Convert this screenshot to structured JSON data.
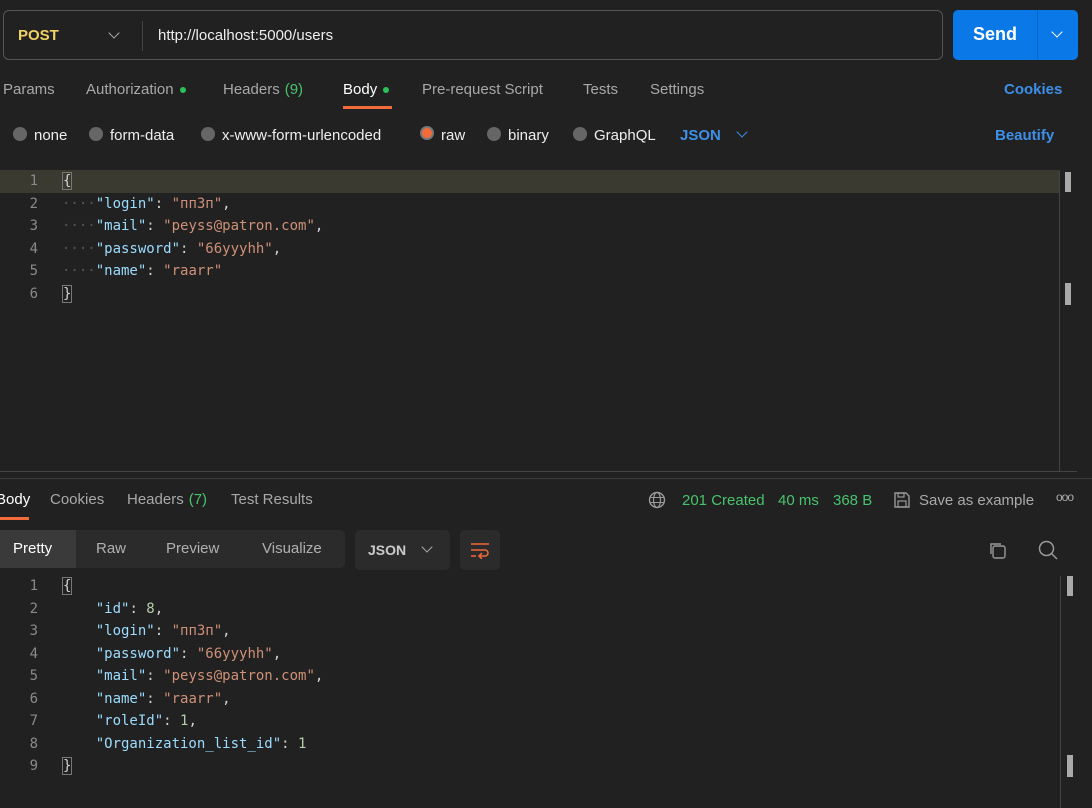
{
  "request": {
    "method": "POST",
    "url": "http://localhost:5000/users",
    "send_label": "Send",
    "tabs": [
      {
        "label": "Params"
      },
      {
        "label": "Authorization",
        "dot": true
      },
      {
        "label": "Headers",
        "count": "(9)"
      },
      {
        "label": "Body",
        "dot": true,
        "active": true
      },
      {
        "label": "Pre-request Script"
      },
      {
        "label": "Tests"
      },
      {
        "label": "Settings"
      }
    ],
    "cookies_label": "Cookies",
    "body_modes": [
      "none",
      "form-data",
      "x-www-form-urlencoded",
      "raw",
      "binary",
      "GraphQL"
    ],
    "selected_mode": "raw",
    "language": "JSON",
    "beautify_label": "Beautify",
    "body_lines": [
      [
        {
          "t": "p",
          "v": "{"
        }
      ],
      [
        {
          "t": "ws",
          "v": "····"
        },
        {
          "t": "k",
          "v": "\"login\""
        },
        {
          "t": "p",
          "v": ": "
        },
        {
          "t": "s",
          "v": "\"пп3п\""
        },
        {
          "t": "p",
          "v": ","
        }
      ],
      [
        {
          "t": "ws",
          "v": "····"
        },
        {
          "t": "k",
          "v": "\"mail\""
        },
        {
          "t": "p",
          "v": ": "
        },
        {
          "t": "s",
          "v": "\"peyss@patron.com\""
        },
        {
          "t": "p",
          "v": ","
        }
      ],
      [
        {
          "t": "ws",
          "v": "····"
        },
        {
          "t": "k",
          "v": "\"password\""
        },
        {
          "t": "p",
          "v": ": "
        },
        {
          "t": "s",
          "v": "\"66yyyhh\""
        },
        {
          "t": "p",
          "v": ","
        }
      ],
      [
        {
          "t": "ws",
          "v": "····"
        },
        {
          "t": "k",
          "v": "\"name\""
        },
        {
          "t": "p",
          "v": ": "
        },
        {
          "t": "s",
          "v": "\"raarr\""
        }
      ],
      [
        {
          "t": "p",
          "v": "}"
        }
      ]
    ]
  },
  "response": {
    "tabs": [
      {
        "label": "Body",
        "active": true
      },
      {
        "label": "Cookies"
      },
      {
        "label": "Headers",
        "count": "(7)"
      },
      {
        "label": "Test Results"
      }
    ],
    "status": "201 Created",
    "time": "40 ms",
    "size": "368 B",
    "save_label": "Save as example",
    "more_label": "ooo",
    "views": [
      "Pretty",
      "Raw",
      "Preview",
      "Visualize"
    ],
    "selected_view": "Pretty",
    "format": "JSON",
    "colors": {
      "status": "#47c46b",
      "accent": "#f26b3a",
      "send": "#0a78e6"
    },
    "body_lines": [
      [
        {
          "t": "p",
          "v": "{"
        }
      ],
      [
        {
          "t": "ws",
          "v": "    "
        },
        {
          "t": "k",
          "v": "\"id\""
        },
        {
          "t": "p",
          "v": ": "
        },
        {
          "t": "n",
          "v": "8"
        },
        {
          "t": "p",
          "v": ","
        }
      ],
      [
        {
          "t": "ws",
          "v": "    "
        },
        {
          "t": "k",
          "v": "\"login\""
        },
        {
          "t": "p",
          "v": ": "
        },
        {
          "t": "s",
          "v": "\"пп3п\""
        },
        {
          "t": "p",
          "v": ","
        }
      ],
      [
        {
          "t": "ws",
          "v": "    "
        },
        {
          "t": "k",
          "v": "\"password\""
        },
        {
          "t": "p",
          "v": ": "
        },
        {
          "t": "s",
          "v": "\"66yyyhh\""
        },
        {
          "t": "p",
          "v": ","
        }
      ],
      [
        {
          "t": "ws",
          "v": "    "
        },
        {
          "t": "k",
          "v": "\"mail\""
        },
        {
          "t": "p",
          "v": ": "
        },
        {
          "t": "s",
          "v": "\"peyss@patron.com\""
        },
        {
          "t": "p",
          "v": ","
        }
      ],
      [
        {
          "t": "ws",
          "v": "    "
        },
        {
          "t": "k",
          "v": "\"name\""
        },
        {
          "t": "p",
          "v": ": "
        },
        {
          "t": "s",
          "v": "\"raarr\""
        },
        {
          "t": "p",
          "v": ","
        }
      ],
      [
        {
          "t": "ws",
          "v": "    "
        },
        {
          "t": "k",
          "v": "\"roleId\""
        },
        {
          "t": "p",
          "v": ": "
        },
        {
          "t": "n",
          "v": "1"
        },
        {
          "t": "p",
          "v": ","
        }
      ],
      [
        {
          "t": "ws",
          "v": "    "
        },
        {
          "t": "k",
          "v": "\"Organization_list_id\""
        },
        {
          "t": "p",
          "v": ": "
        },
        {
          "t": "n",
          "v": "1"
        }
      ],
      [
        {
          "t": "p",
          "v": "}"
        }
      ]
    ]
  }
}
